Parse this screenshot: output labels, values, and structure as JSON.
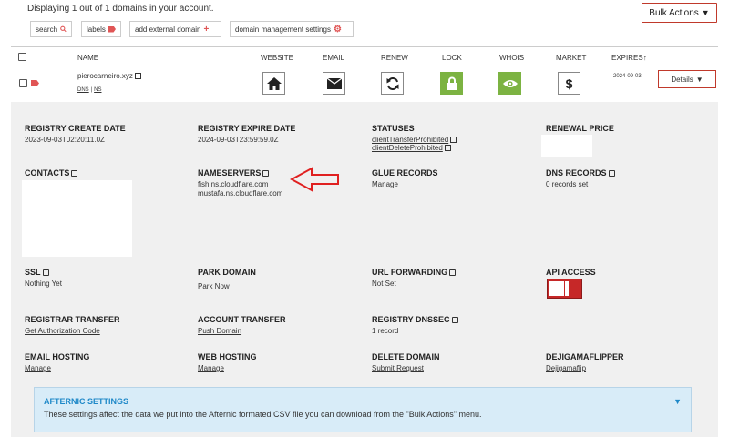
{
  "top": {
    "display_text": "Displaying 1 out of 1 domains in your account.",
    "bulk_actions_label": "Bulk Actions"
  },
  "filters": {
    "search_label": "search",
    "labels_label": "labels",
    "add_external_label": "add external domain",
    "settings_label": "domain management settings"
  },
  "columns": {
    "name": "NAME",
    "website": "WEBSITE",
    "email": "EMAIL",
    "renew": "RENEW",
    "lock": "LOCK",
    "whois": "WHOIS",
    "market": "MARKET",
    "expires": "EXPIRES"
  },
  "domain": {
    "name": "pierocarneiro.xyz",
    "dns_link": "DNS",
    "ns_link": "NS",
    "expires": "2024-09-03",
    "details_label": "Details"
  },
  "details": {
    "registry_create_date": {
      "label": "REGISTRY CREATE DATE",
      "value": "2023-09-03T02:20:11.0Z"
    },
    "registry_expire_date": {
      "label": "REGISTRY EXPIRE DATE",
      "value": "2024-09-03T23:59:59.0Z"
    },
    "statuses": {
      "label": "STATUSES",
      "values": [
        "clientTransferProhibited",
        "clientDeleteProhibited"
      ]
    },
    "renewal_price": {
      "label": "RENEWAL PRICE"
    },
    "contacts": {
      "label": "CONTACTS"
    },
    "nameservers": {
      "label": "NAMESERVERS",
      "values": [
        "fish.ns.cloudflare.com",
        "mustafa.ns.cloudflare.com"
      ]
    },
    "glue_records": {
      "label": "GLUE RECORDS",
      "link": "Manage"
    },
    "dns_records": {
      "label": "DNS RECORDS",
      "value": "0 records set"
    },
    "ssl": {
      "label": "SSL",
      "value": "Nothing Yet"
    },
    "park_domain": {
      "label": "PARK DOMAIN",
      "link": "Park Now"
    },
    "url_forwarding": {
      "label": "URL FORWARDING",
      "value": "Not Set"
    },
    "api_access": {
      "label": "API ACCESS"
    },
    "registrar_transfer": {
      "label": "REGISTRAR TRANSFER",
      "link": "Get Authorization Code"
    },
    "account_transfer": {
      "label": "ACCOUNT TRANSFER",
      "link": "Push Domain"
    },
    "registry_dnssec": {
      "label": "REGISTRY DNSSEC",
      "value": "1 record"
    },
    "email_hosting": {
      "label": "EMAIL HOSTING",
      "link": "Manage"
    },
    "web_hosting": {
      "label": "WEB HOSTING",
      "link": "Manage"
    },
    "delete_domain": {
      "label": "DELETE DOMAIN",
      "link": "Submit Request"
    },
    "dejigamaflipper": {
      "label": "DEJIGAMAFLIPPER",
      "link": "Dejigamaflip"
    }
  },
  "afternic": {
    "title": "AFTERNIC SETTINGS",
    "description": "These settings affect the data we put into the Afternic formated CSV file you can download from the \"Bulk Actions\" menu."
  },
  "colors": {
    "accent_red": "#c0392b",
    "lock_green": "#7cb342",
    "afternic_blue": "#1e88c8"
  }
}
